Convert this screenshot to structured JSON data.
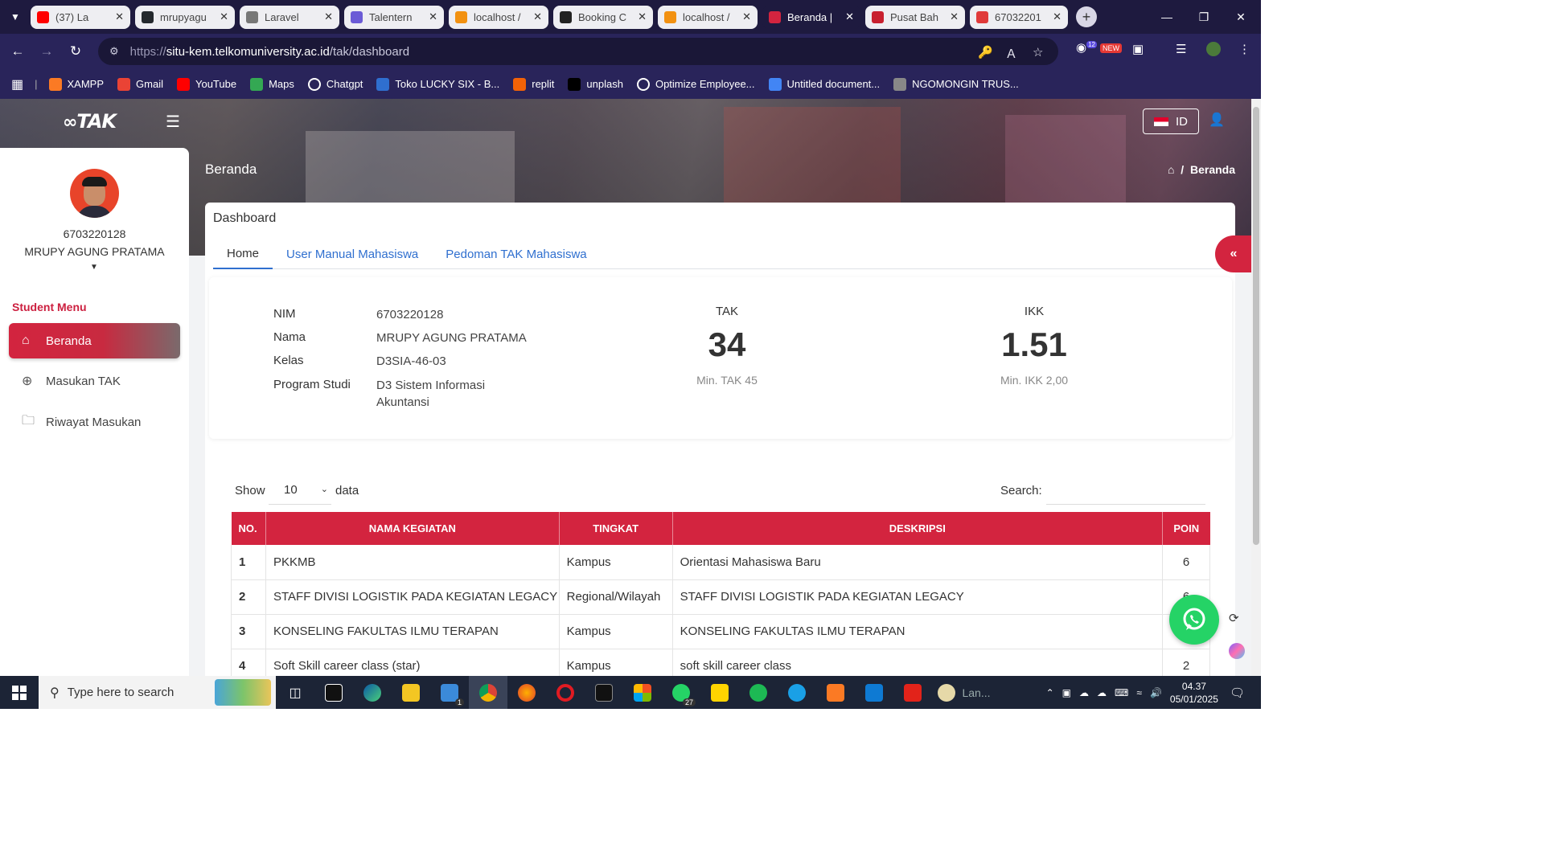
{
  "browser": {
    "tabs": [
      {
        "title": "(37) La",
        "icon": "youtube-icon",
        "color": "#ff0000",
        "active": false
      },
      {
        "title": "mrupyagu",
        "icon": "github-icon",
        "color": "#24292e",
        "active": false
      },
      {
        "title": "Laravel",
        "icon": "globe-icon",
        "color": "#777777",
        "active": false
      },
      {
        "title": "Talentern",
        "icon": "talentern-icon",
        "color": "#6b5bd6",
        "active": false
      },
      {
        "title": "localhost /",
        "icon": "phpmyadmin-icon",
        "color": "#f29111",
        "active": false
      },
      {
        "title": "Booking C",
        "icon": "chatgpt-icon",
        "color": "#222222",
        "active": false
      },
      {
        "title": "localhost /",
        "icon": "phpmyadmin-icon",
        "color": "#f29111",
        "active": false
      },
      {
        "title": "Beranda |",
        "icon": "tak-icon",
        "color": "#d3243f",
        "active": true
      },
      {
        "title": "Pusat Bah",
        "icon": "telkom-icon",
        "color": "#c8202f",
        "active": false
      },
      {
        "title": "67032201",
        "icon": "pdf-icon",
        "color": "#e03a3a",
        "active": false
      }
    ],
    "url_scheme": "https://",
    "url_host": "situ-kem.telkomuniversity.ac.id",
    "url_path": "/tak/dashboard",
    "ext_badge_count": "12",
    "ext_new_label": "NEW",
    "bookmarks": [
      {
        "label": "XAMPP",
        "icon": "xampp-icon",
        "color": "#fb7a24"
      },
      {
        "label": "Gmail",
        "icon": "gmail-icon",
        "color": "#ea4335"
      },
      {
        "label": "YouTube",
        "icon": "youtube-icon",
        "color": "#ff0000"
      },
      {
        "label": "Maps",
        "icon": "maps-icon",
        "color": "#34a853"
      },
      {
        "label": "Chatgpt",
        "icon": "chatgpt-icon",
        "color": "#ffffff"
      },
      {
        "label": "Toko LUCKY SIX - B...",
        "icon": "shop-icon",
        "color": "#2f6fcf"
      },
      {
        "label": "replit",
        "icon": "replit-icon",
        "color": "#f26207"
      },
      {
        "label": "unplash",
        "icon": "unsplash-icon",
        "color": "#000000"
      },
      {
        "label": "Optimize Employee...",
        "icon": "chatgpt-icon",
        "color": "#ffffff"
      },
      {
        "label": "Untitled document...",
        "icon": "docs-icon",
        "color": "#4285f4"
      },
      {
        "label": "NGOMONGIN TRUS...",
        "icon": "globe-icon",
        "color": "#888888"
      }
    ]
  },
  "header": {
    "logo": "TAK",
    "lang": "ID",
    "page_title": "Beranda",
    "breadcrumb": "Beranda"
  },
  "sidebar": {
    "nim": "6703220128",
    "name": "MRUPY AGUNG PRATAMA",
    "menu_title": "Student Menu",
    "items": [
      {
        "label": "Beranda",
        "icon": "home-icon",
        "active": true
      },
      {
        "label": "Masukan TAK",
        "icon": "plus-circle-icon",
        "active": false
      },
      {
        "label": "Riwayat Masukan",
        "icon": "folder-icon",
        "active": false
      }
    ]
  },
  "dashboard": {
    "title": "Dashboard",
    "tabs": [
      "Home",
      "User Manual Mahasiswa",
      "Pedoman TAK Mahasiswa"
    ],
    "profile": [
      {
        "label": "NIM",
        "value": "6703220128"
      },
      {
        "label": "Nama",
        "value": "MRUPY AGUNG PRATAMA"
      },
      {
        "label": "Kelas",
        "value": "D3SIA-46-03"
      },
      {
        "label": "Program Studi",
        "value": "D3 Sistem Informasi Akuntansi"
      }
    ],
    "tak": {
      "label": "TAK",
      "value": "34",
      "min": "Min. TAK 45"
    },
    "ikk": {
      "label": "IKK",
      "value": "1.51",
      "min": "Min. IKK 2,00"
    }
  },
  "table": {
    "show_label": "Show",
    "page_size": "10",
    "data_label": "data",
    "search_label": "Search:",
    "search_value": "",
    "columns": [
      "NO.",
      "NAMA KEGIATAN",
      "TINGKAT",
      "DESKRIPSI",
      "POIN"
    ],
    "rows": [
      [
        "1",
        "PKKMB",
        "Kampus",
        "Orientasi Mahasiswa Baru",
        "6"
      ],
      [
        "2",
        "STAFF DIVISI LOGISTIK PADA KEGIATAN LEGACY",
        "Regional/Wilayah",
        "STAFF DIVISI LOGISTIK PADA KEGIATAN LEGACY",
        "6"
      ],
      [
        "3",
        "KONSELING FAKULTAS ILMU TERAPAN",
        "Kampus",
        "KONSELING FAKULTAS ILMU TERAPAN",
        ""
      ],
      [
        "4",
        "Soft Skill career class (star)",
        "Kampus",
        "soft skill career class",
        "2"
      ]
    ]
  },
  "taskbar": {
    "search_placeholder": "Type here to search",
    "lang_app_label": "Lan...",
    "time": "04.37",
    "date": "05/01/2025",
    "mail_badge": "1",
    "whatsapp_badge": "27"
  },
  "colors": {
    "brand_red": "#d3243f",
    "link_blue": "#2f6fcf",
    "chrome_dark": "#1e1a3f",
    "chrome_mid": "#29245a"
  }
}
